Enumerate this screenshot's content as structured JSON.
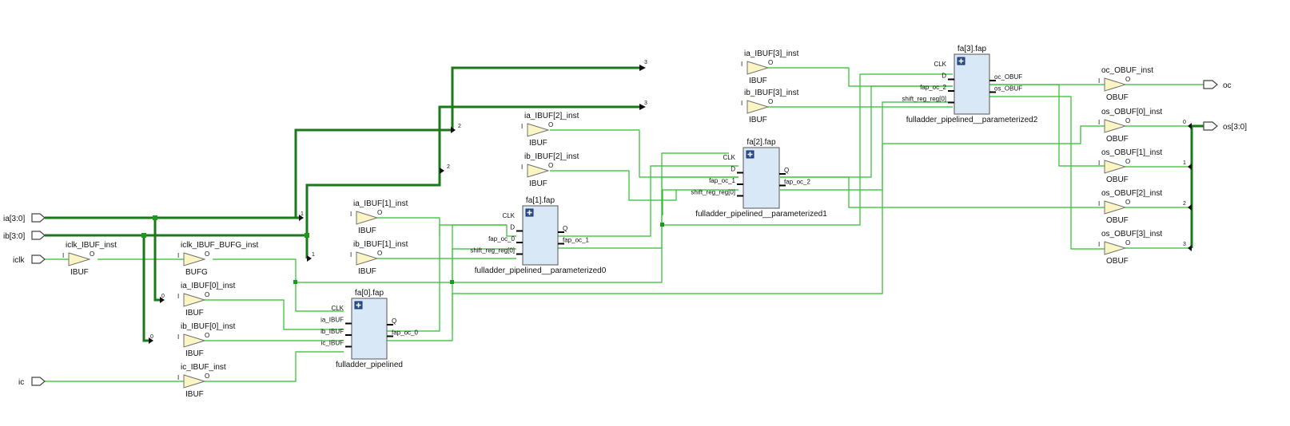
{
  "ports_in": [
    {
      "label": "ia[3:0]"
    },
    {
      "label": "ib[3:0]"
    },
    {
      "label": "iclk"
    },
    {
      "label": "ic"
    }
  ],
  "ports_out": [
    {
      "label": "oc"
    },
    {
      "label": "os[3:0]"
    }
  ],
  "pins": {
    "i": "I",
    "o": "O"
  },
  "buffers": [
    {
      "inst": "iclk_IBUF_inst",
      "type": "IBUF"
    },
    {
      "inst": "iclk_IBUF_BUFG_inst",
      "type": "BUFG"
    },
    {
      "inst": "ia_IBUF[0]_inst",
      "type": "IBUF"
    },
    {
      "inst": "ib_IBUF[0]_inst",
      "type": "IBUF"
    },
    {
      "inst": "ic_IBUF_inst",
      "type": "IBUF"
    },
    {
      "inst": "ia_IBUF[1]_inst",
      "type": "IBUF"
    },
    {
      "inst": "ib_IBUF[1]_inst",
      "type": "IBUF"
    },
    {
      "inst": "ia_IBUF[2]_inst",
      "type": "IBUF"
    },
    {
      "inst": "ib_IBUF[2]_inst",
      "type": "IBUF"
    },
    {
      "inst": "ia_IBUF[3]_inst",
      "type": "IBUF"
    },
    {
      "inst": "ib_IBUF[3]_inst",
      "type": "IBUF"
    },
    {
      "inst": "oc_OBUF_inst",
      "type": "OBUF"
    },
    {
      "inst": "os_OBUF[0]_inst",
      "type": "OBUF"
    },
    {
      "inst": "os_OBUF[1]_inst",
      "type": "OBUF"
    },
    {
      "inst": "os_OBUF[2]_inst",
      "type": "OBUF"
    },
    {
      "inst": "os_OBUF[3]_inst",
      "type": "OBUF"
    }
  ],
  "blocks": [
    {
      "inst": "fa[0].fap",
      "module": "fulladder_pipelined",
      "left_pins": [
        "CLK",
        "ia_IBUF",
        "ib_IBUF",
        "ic_IBUF"
      ],
      "right_pins": [
        "Q",
        "fap_oc_0"
      ]
    },
    {
      "inst": "fa[1].fap",
      "module": "fulladder_pipelined__parameterized0",
      "left_pins": [
        "CLK",
        "D",
        "fap_oc_0",
        "shift_reg_reg[0]"
      ],
      "right_pins": [
        "Q",
        "fap_oc_1"
      ]
    },
    {
      "inst": "fa[2].fap",
      "module": "fulladder_pipelined__parameterized1",
      "left_pins": [
        "CLK",
        "D",
        "fap_oc_1",
        "shift_reg_reg[0]"
      ],
      "right_pins": [
        "Q",
        "fap_oc_2"
      ]
    },
    {
      "inst": "fa[3].fap",
      "module": "fulladder_pipelined__parameterized2",
      "left_pins": [
        "CLK",
        "D",
        "fap_oc_2",
        "shift_reg_reg[0]"
      ],
      "right_pins": [
        "oc_OBUF",
        "os_OBUF"
      ]
    }
  ],
  "bit_labels": {
    "ia0": "0",
    "ib0": "0",
    "ia1": "1",
    "ib1": "1",
    "ia2": "2",
    "ib2": "2",
    "ia3": "3",
    "ib3": "3",
    "os0": "0",
    "os1": "1",
    "os2": "2",
    "os3": "3"
  },
  "colors": {
    "wire": "#2fbf2f",
    "bus": "#1a7a1a",
    "buffer_fill": "#fbf5c4",
    "block_fill": "#d9e8f7"
  }
}
